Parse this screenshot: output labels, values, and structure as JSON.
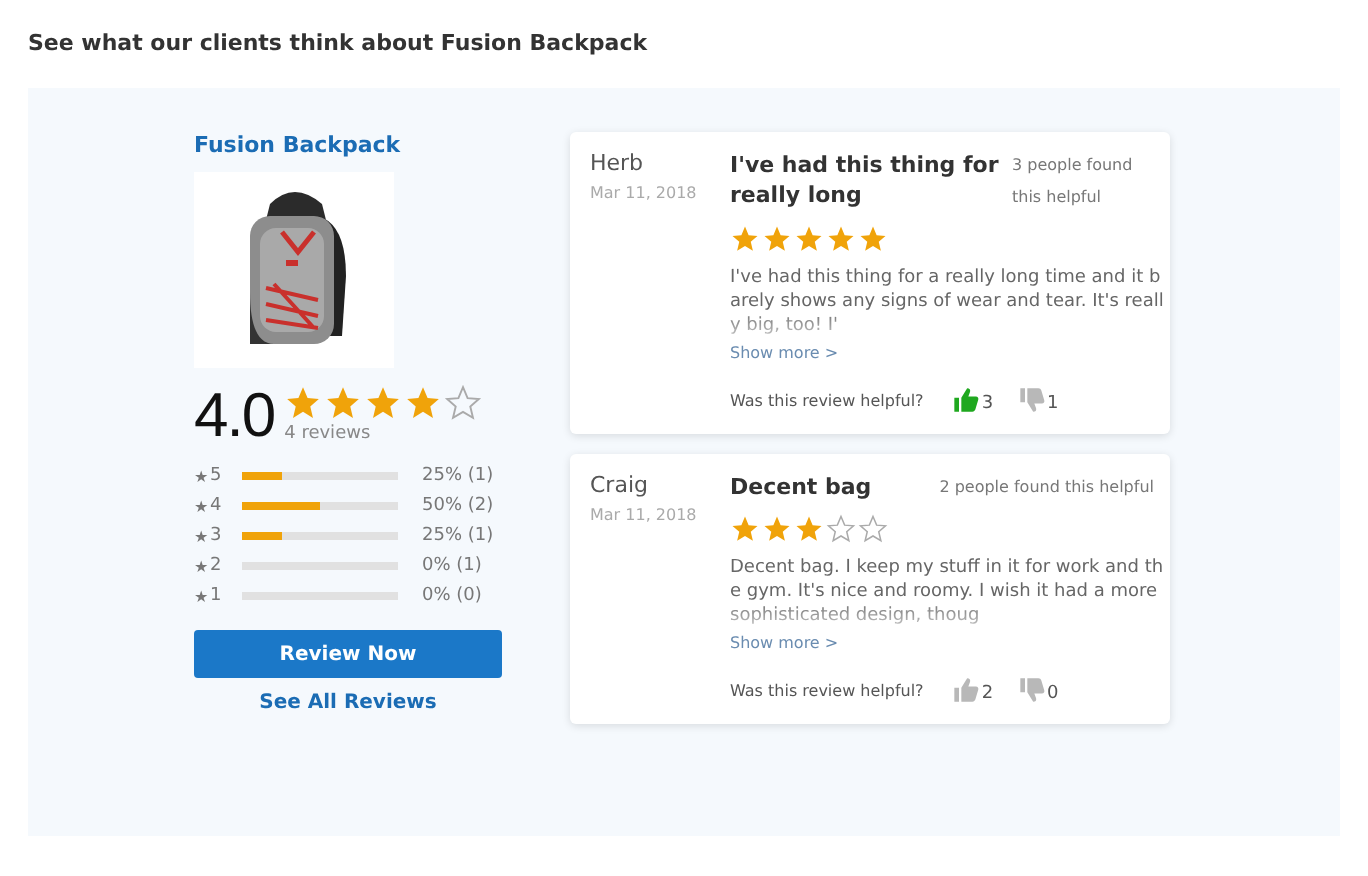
{
  "heading": "See what our clients think about Fusion Backpack",
  "product": {
    "name": "Fusion Backpack",
    "rating": "4.0",
    "stars": 4,
    "review_count": "4 reviews",
    "histogram": [
      {
        "star": "★",
        "label": "5",
        "level": 0.25,
        "reading": "25% (1)"
      },
      {
        "star": "★",
        "label": "4",
        "level": 0.5,
        "reading": "50% (2)"
      },
      {
        "star": "★",
        "label": "3",
        "level": 0.25,
        "reading": "25% (1)"
      },
      {
        "star": "★",
        "label": "2",
        "level": 0,
        "reading": "0% (1)"
      },
      {
        "star": "★",
        "label": "1",
        "level": 0,
        "reading": "0% (0)"
      }
    ],
    "review_button": "Review Now",
    "see_all_link": "See All Reviews"
  },
  "reviews": [
    {
      "author": "Herb",
      "date": "Mar 11, 2018",
      "title": "I've had this thing for really long",
      "helpful_count": "3 people found this helpful",
      "stars": 5,
      "body": "I've had this thing for a really long time and it barely shows any signs of wear and tear. It's really big, too! I'",
      "show_more": "Show more >",
      "helpful_question": "Was this review helpful?",
      "up_count": "3",
      "down_count": "1",
      "voted_up": true
    },
    {
      "author": "Craig",
      "date": "Mar 11, 2018",
      "title": "Decent bag",
      "helpful_count": "2 people found this helpful",
      "stars": 3,
      "body": "Decent bag. I keep my stuff in it for work and the gym. It's nice and roomy. I wish it had a more sophisticated design, thoug",
      "show_more": "Show more >",
      "helpful_question": "Was this review helpful?",
      "up_count": "2",
      "down_count": "0",
      "voted_up": false
    }
  ]
}
